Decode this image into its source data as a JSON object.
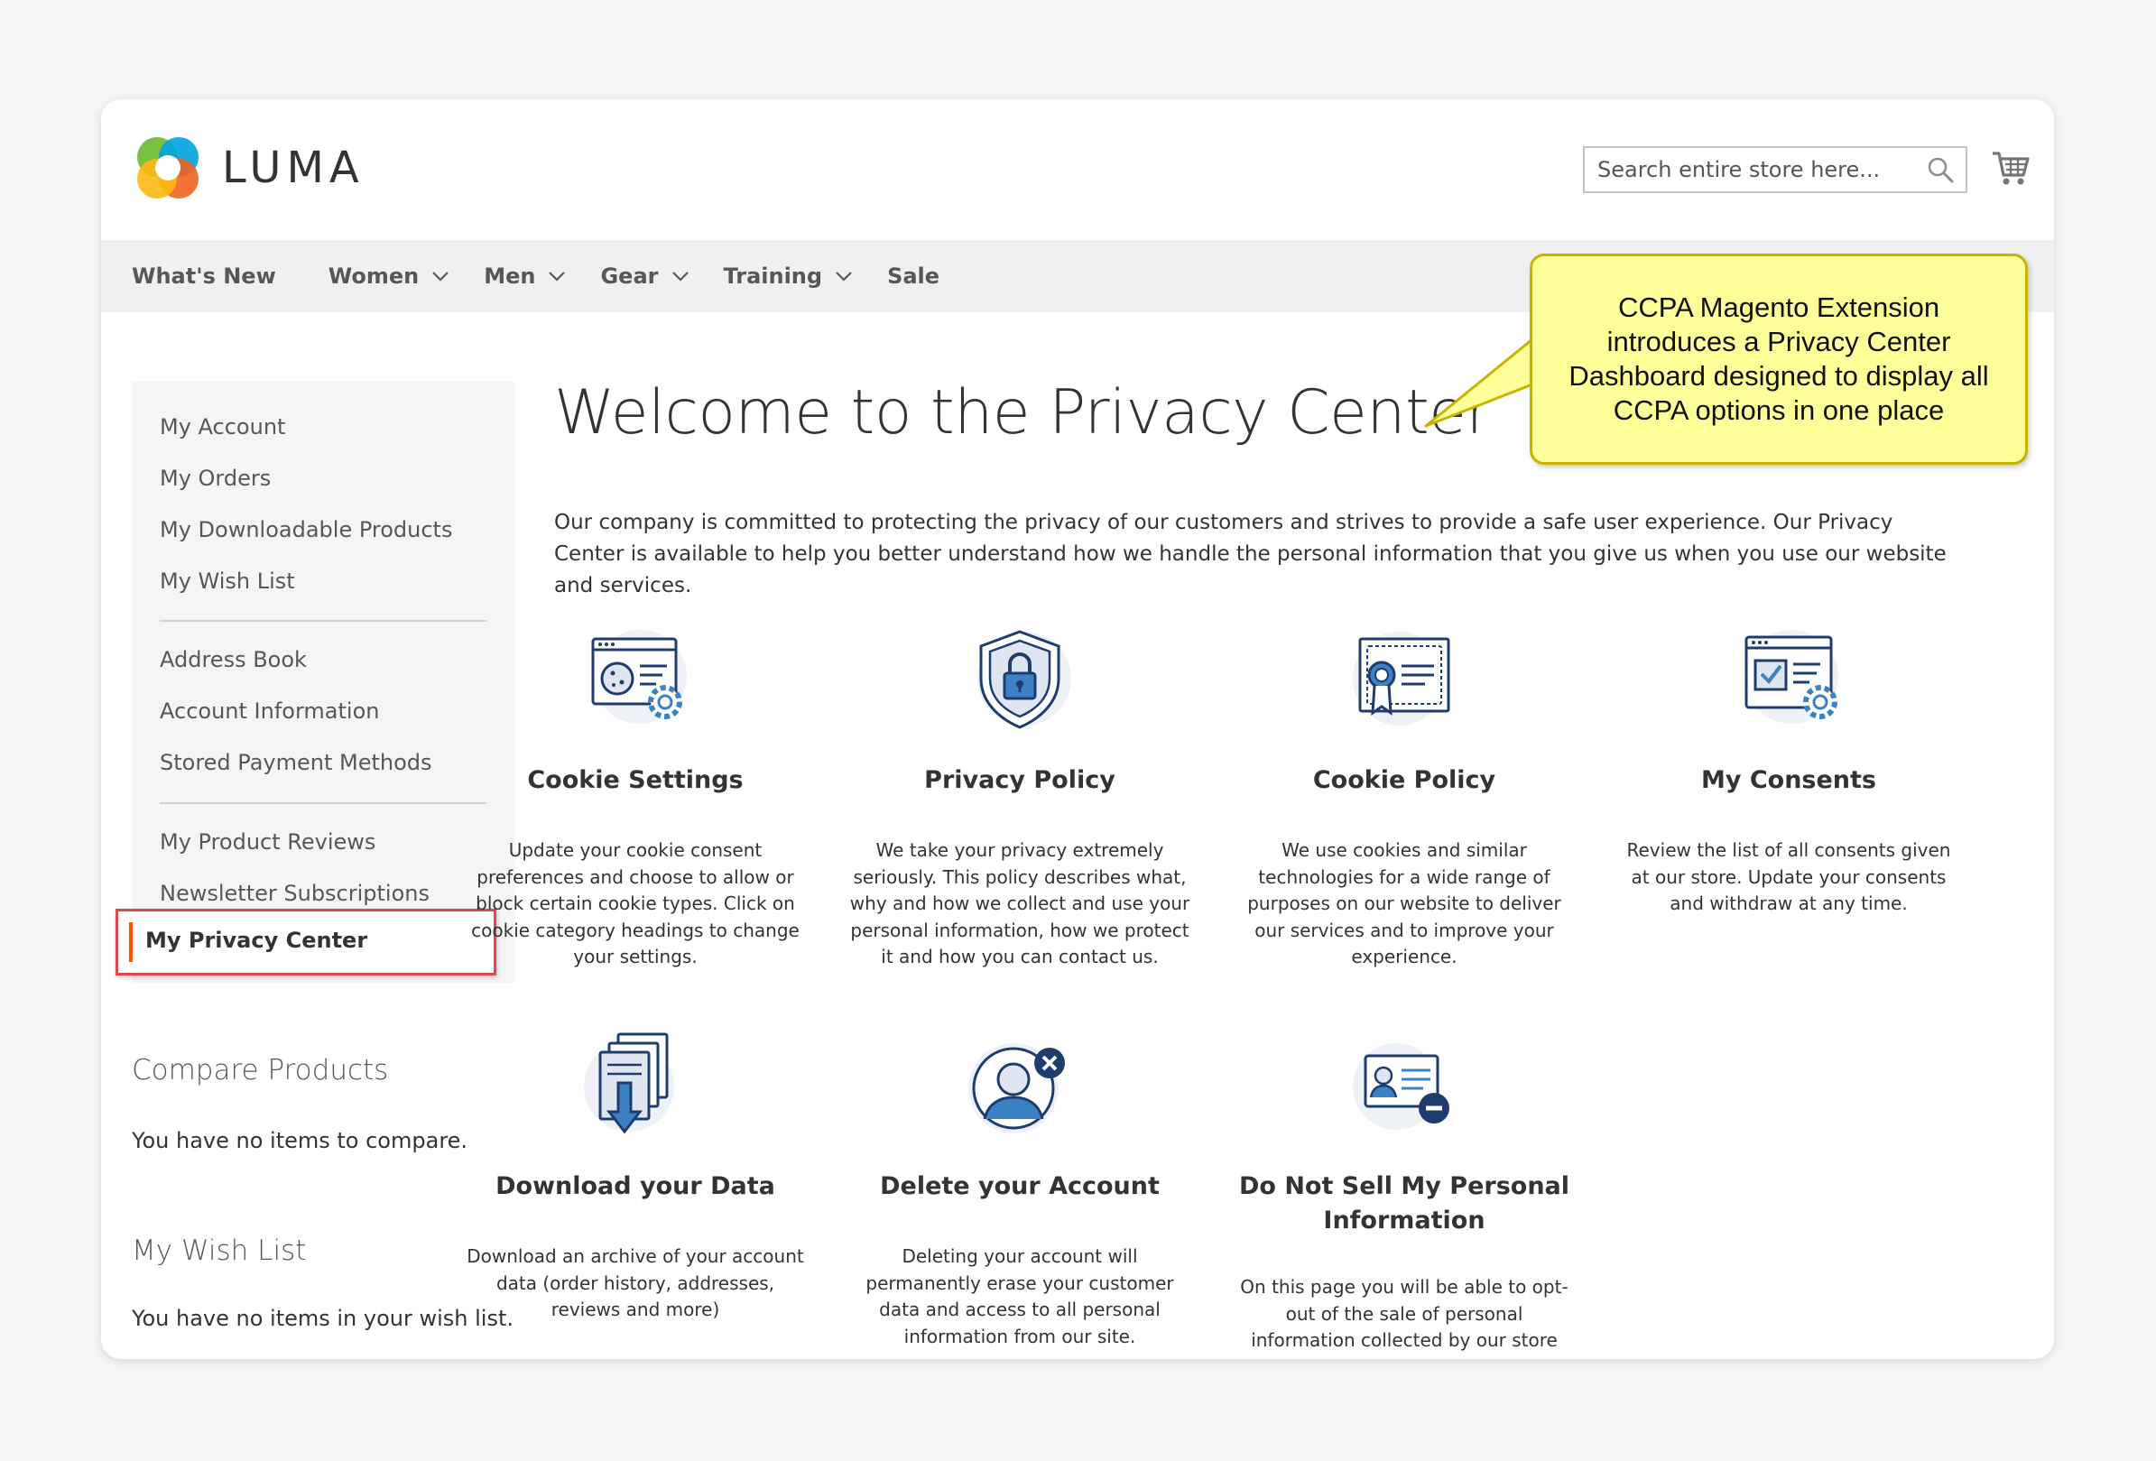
{
  "header": {
    "logo_text": "LUMA",
    "search_placeholder": "Search entire store here...",
    "colors": {
      "accent": "#ff5501",
      "link": "#575757"
    }
  },
  "nav": {
    "items": [
      {
        "label": "What's New",
        "dropdown": false
      },
      {
        "label": "Women",
        "dropdown": true
      },
      {
        "label": "Men",
        "dropdown": true
      },
      {
        "label": "Gear",
        "dropdown": true
      },
      {
        "label": "Training",
        "dropdown": true
      },
      {
        "label": "Sale",
        "dropdown": false
      }
    ]
  },
  "callout": {
    "text": "CCPA Magento Extension introduces a Privacy Center Dashboard designed to display all CCPA options in one place"
  },
  "sidebar": {
    "links": [
      "My Account",
      "My Orders",
      "My Downloadable Products",
      "My Wish List",
      "Address Book",
      "Account Information",
      "Stored Payment Methods",
      "My Product Reviews",
      "Newsletter Subscriptions"
    ],
    "active": "My Privacy Center"
  },
  "compare": {
    "title": "Compare Products",
    "text": "You have no items to compare."
  },
  "wishlist": {
    "title": "My Wish List",
    "text": "You have no items in your wish list."
  },
  "main": {
    "title": "Welcome to the Privacy Center",
    "intro": "Our company is committed to protecting the privacy of our customers and strives to provide a safe user experience. Our Privacy Center is available to help you better understand how we handle the personal information that you give us when you use our website and services.",
    "tiles": [
      {
        "icon": "cookie-settings-icon",
        "title": "Cookie Settings",
        "text": "Update your cookie consent preferences and choose to allow or block certain cookie types. Click on cookie category headings to change your settings."
      },
      {
        "icon": "privacy-shield-icon",
        "title": "Privacy Policy",
        "text": "We take your privacy extremely seriously. This policy describes what, why and how we collect and use your personal information, how we protect it and how you can contact us."
      },
      {
        "icon": "certificate-icon",
        "title": "Cookie Policy",
        "text": "We use cookies and similar technologies for a wide range of purposes on our website to deliver our services and to improve your experience."
      },
      {
        "icon": "consents-icon",
        "title": "My Consents",
        "text": "Review the list of all consents given at our store. Update your consents and withdraw at any time."
      },
      {
        "icon": "download-documents-icon",
        "title": "Download your Data",
        "text": "Download an archive of your account data (order history, addresses, reviews and more)"
      },
      {
        "icon": "delete-user-icon",
        "title": "Delete your Account",
        "text": "Deleting your account will permanently erase your customer data and access to all personal information from our site."
      },
      {
        "icon": "id-card-minus-icon",
        "title": "Do Not Sell My Personal Information",
        "text": "On this page you will be able to opt-out of the sale of personal information collected by our store"
      }
    ]
  }
}
